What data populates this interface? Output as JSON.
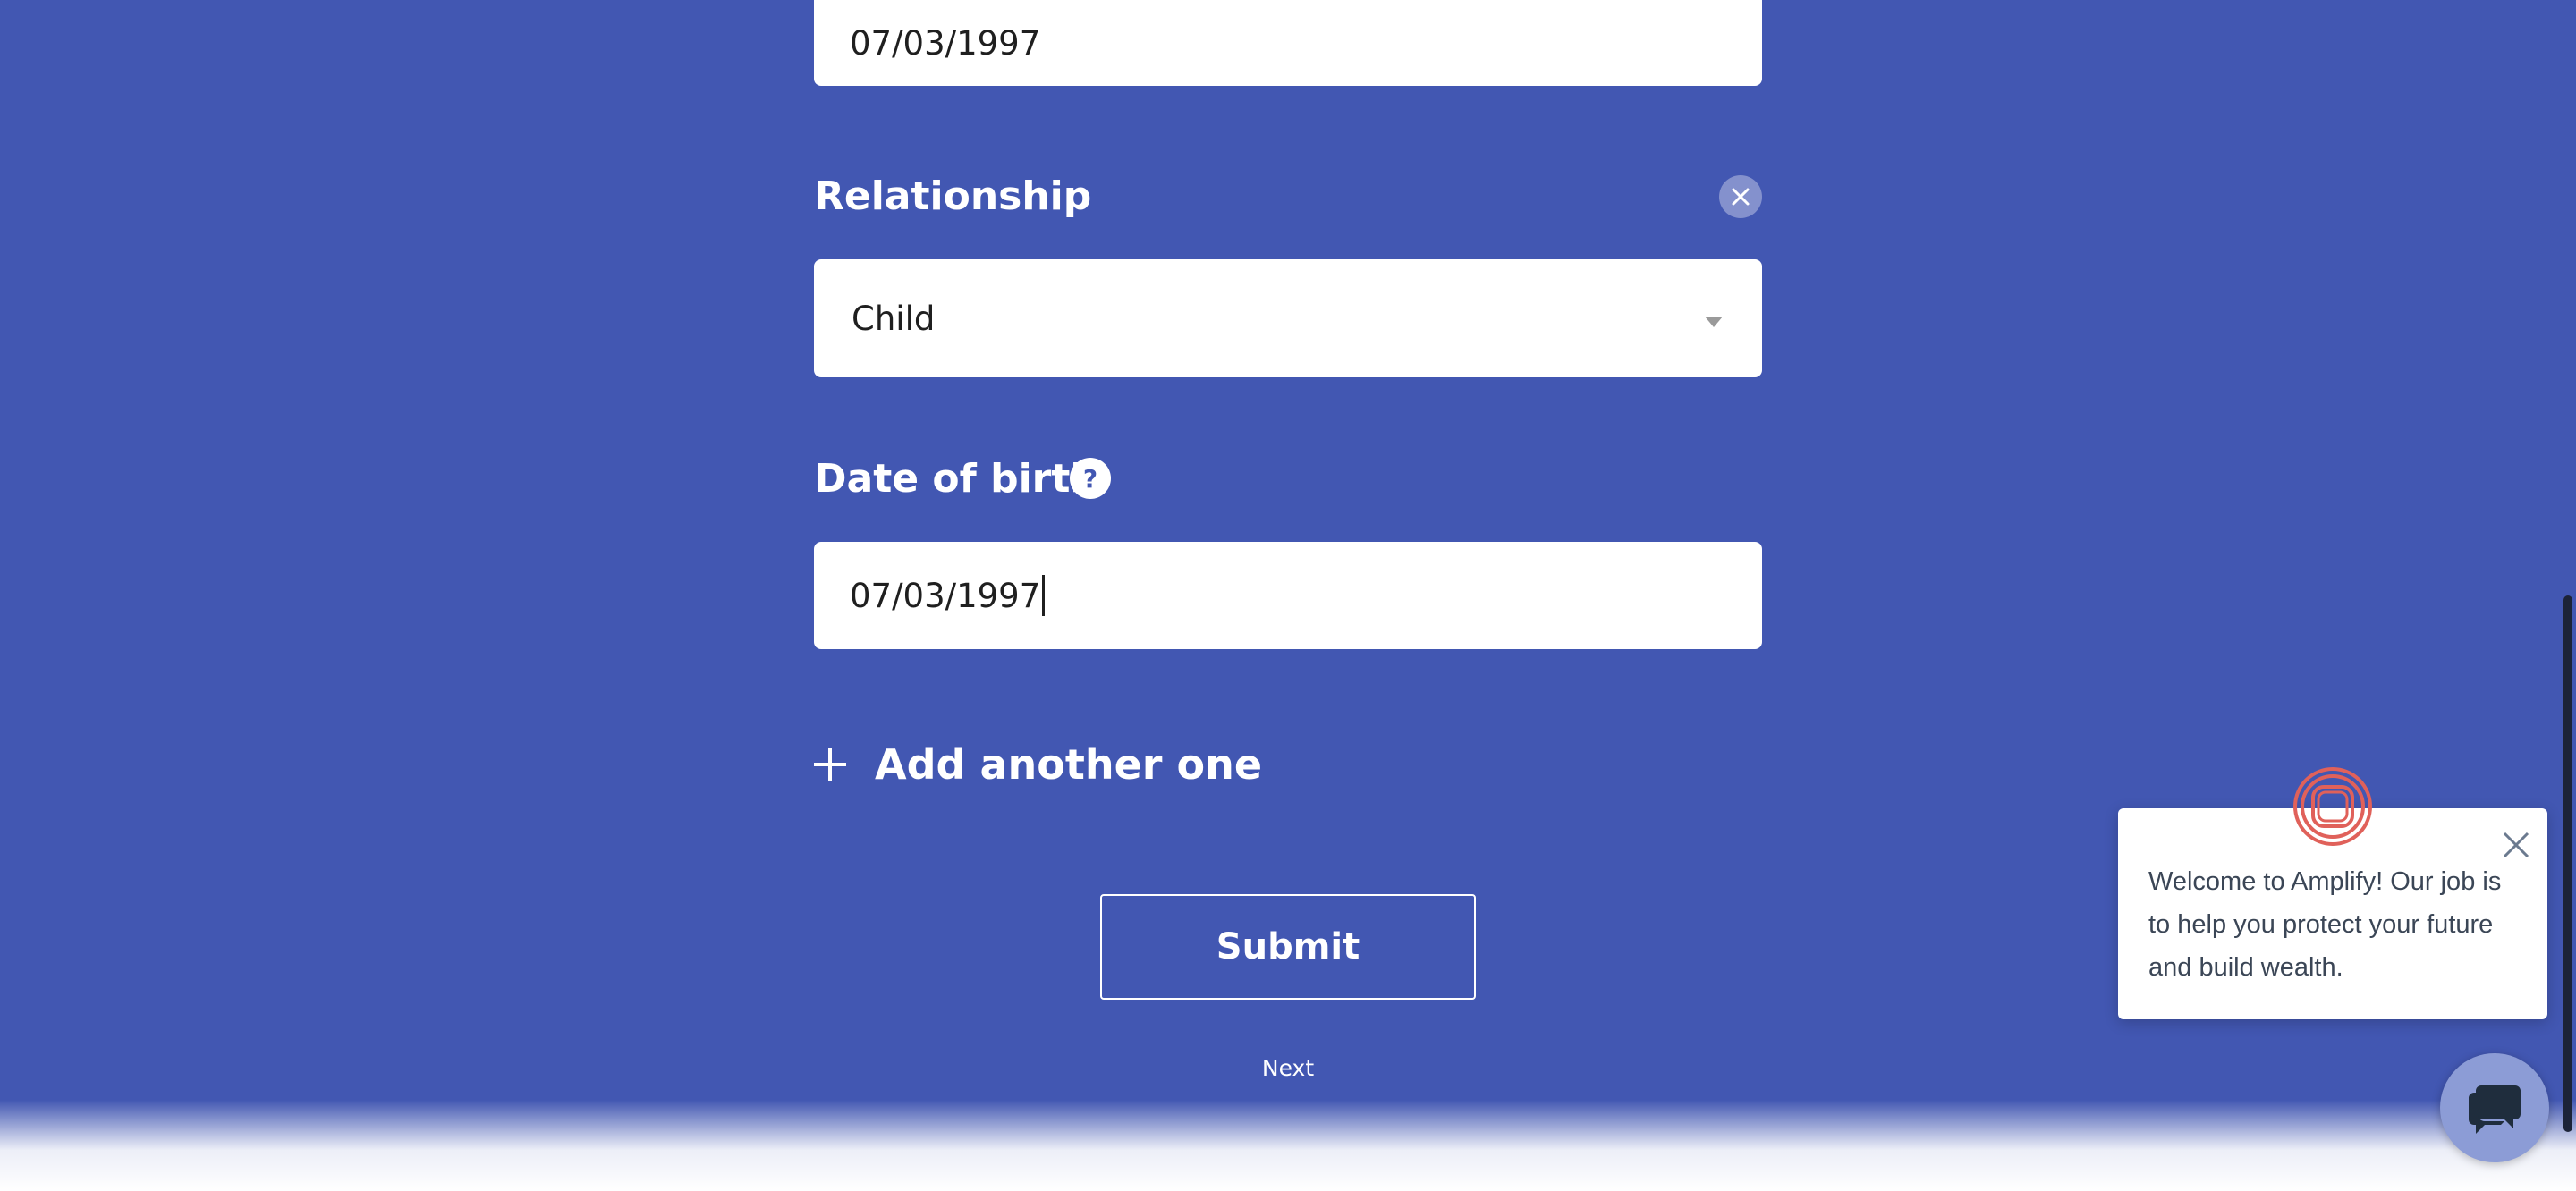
{
  "form": {
    "previous_date_value": "07/03/1997",
    "relationship_label": "Relationship",
    "relationship_value": "Child",
    "dob_label": "Date of birth",
    "dob_help_symbol": "?",
    "dob_value": "07/03/1997",
    "add_another_label": "Add another one",
    "submit_label": "Submit",
    "next_label": "Next"
  },
  "chat": {
    "welcome_message": "Welcome to Amplify! Our job is to help you protect your future and build wealth.",
    "logo_icon": "amplify-logo-icon",
    "launcher_icon": "chat-bubbles-icon"
  },
  "colors": {
    "background": "#4257B2",
    "logo": "#E0615A",
    "launcher": "#8C9CD6"
  }
}
